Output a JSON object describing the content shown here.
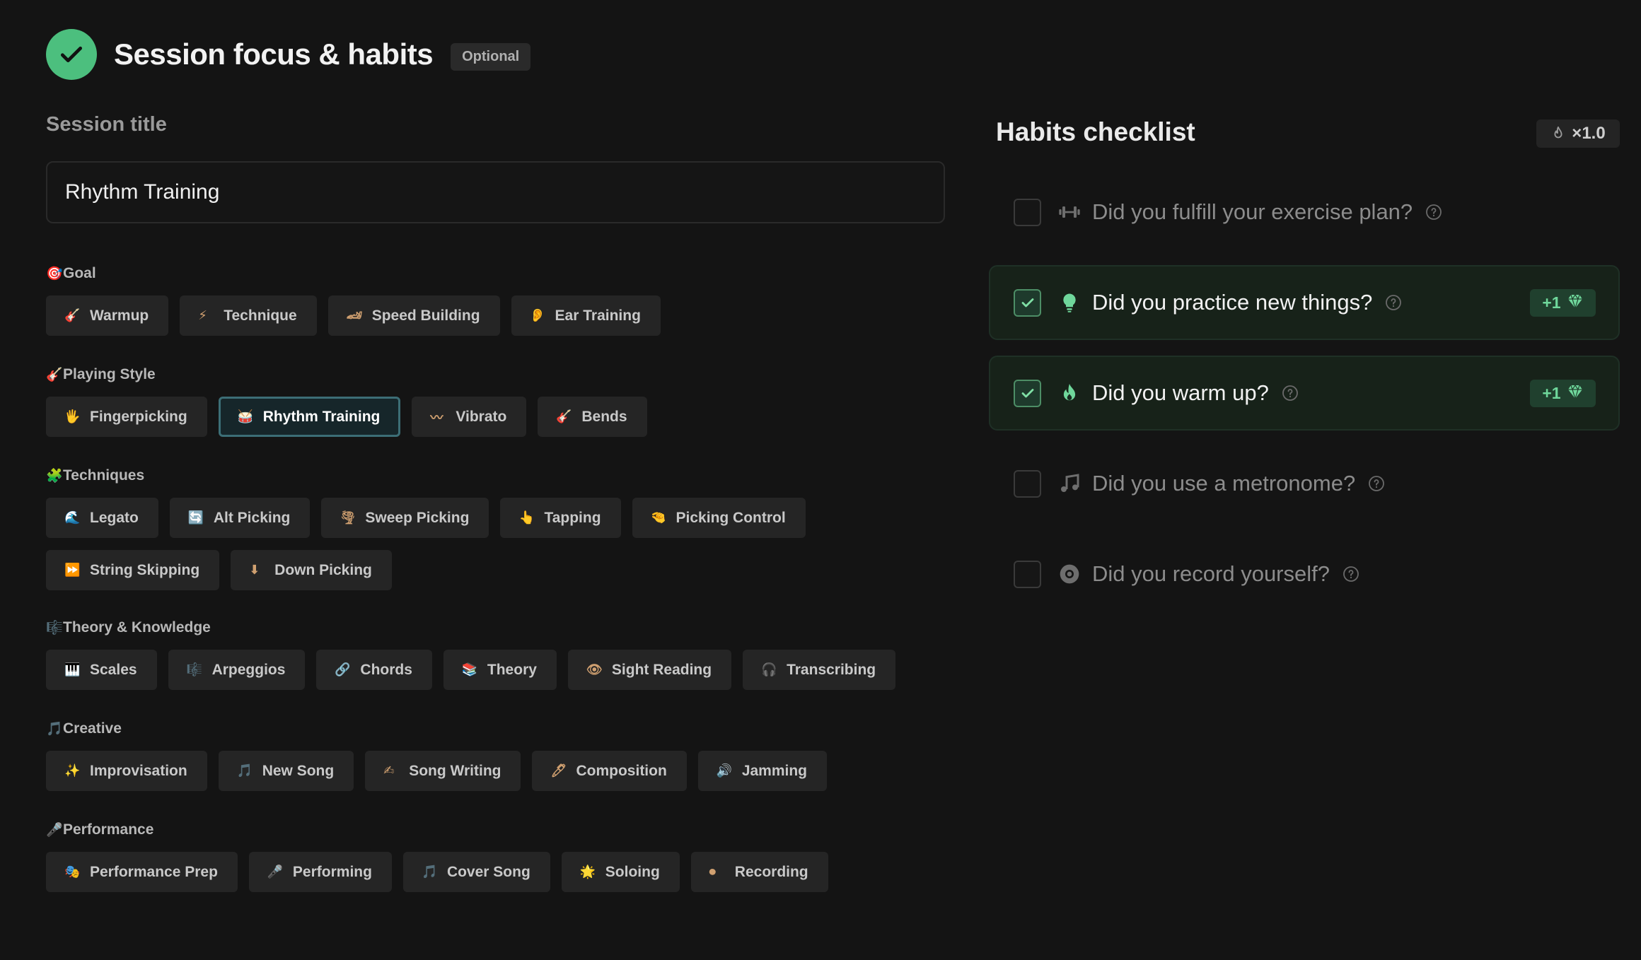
{
  "header": {
    "title": "Session focus & habits",
    "badge": "Optional"
  },
  "session_title": {
    "label": "Session title",
    "value": "Rhythm Training"
  },
  "groups": [
    {
      "icon": "🎯",
      "label": "Goal",
      "chips": [
        {
          "icon": "🎸",
          "label": "Warmup"
        },
        {
          "icon": "⚡",
          "label": "Technique"
        },
        {
          "icon": "🏎",
          "label": "Speed Building"
        },
        {
          "icon": "👂",
          "label": "Ear Training"
        }
      ]
    },
    {
      "icon": "🎸",
      "label": "Playing Style",
      "chips": [
        {
          "icon": "🖐",
          "label": "Fingerpicking"
        },
        {
          "icon": "🥁",
          "label": "Rhythm Training",
          "selected": true
        },
        {
          "icon": "〰",
          "label": "Vibrato"
        },
        {
          "icon": "🎸",
          "label": "Bends"
        }
      ]
    },
    {
      "icon": "🧩",
      "label": "Techniques",
      "chips": [
        {
          "icon": "🌊",
          "label": "Legato"
        },
        {
          "icon": "🔄",
          "label": "Alt Picking"
        },
        {
          "icon": "🌪",
          "label": "Sweep Picking"
        },
        {
          "icon": "👆",
          "label": "Tapping"
        },
        {
          "icon": "🤏",
          "label": "Picking Control"
        },
        {
          "icon": "⏩",
          "label": "String Skipping"
        },
        {
          "icon": "⬇",
          "label": "Down Picking"
        }
      ]
    },
    {
      "icon": "🎼",
      "label": "Theory & Knowledge",
      "chips": [
        {
          "icon": "🎹",
          "label": "Scales"
        },
        {
          "icon": "🎼",
          "label": "Arpeggios"
        },
        {
          "icon": "🔗",
          "label": "Chords"
        },
        {
          "icon": "📚",
          "label": "Theory"
        },
        {
          "icon": "👁",
          "label": "Sight Reading"
        },
        {
          "icon": "🎧",
          "label": "Transcribing"
        }
      ]
    },
    {
      "icon": "🎵",
      "label": "Creative",
      "chips": [
        {
          "icon": "✨",
          "label": "Improvisation"
        },
        {
          "icon": "🎵",
          "label": "New Song"
        },
        {
          "icon": "✍",
          "label": "Song Writing"
        },
        {
          "icon": "🖊",
          "label": "Composition"
        },
        {
          "icon": "🔊",
          "label": "Jamming"
        }
      ]
    },
    {
      "icon": "🎤",
      "label": "Performance",
      "chips": [
        {
          "icon": "🎭",
          "label": "Performance Prep"
        },
        {
          "icon": "🎤",
          "label": "Performing"
        },
        {
          "icon": "🎵",
          "label": "Cover Song"
        },
        {
          "icon": "🌟",
          "label": "Soloing"
        },
        {
          "icon": "⏺",
          "label": "Recording"
        }
      ]
    }
  ],
  "habits": {
    "title": "Habits checklist",
    "multiplier": "×1.0",
    "items": [
      {
        "label": "Did you fulfill your exercise plan?",
        "icon": "dumbbell-icon",
        "checked": false
      },
      {
        "label": "Did you practice new things?",
        "icon": "lightbulb-icon",
        "checked": true,
        "bonus": "+1"
      },
      {
        "label": "Did you warm up?",
        "icon": "flame-icon",
        "checked": true,
        "bonus": "+1"
      },
      {
        "label": "Did you use a metronome?",
        "icon": "music-note-icon",
        "checked": false
      },
      {
        "label": "Did you record yourself?",
        "icon": "record-icon",
        "checked": false
      }
    ]
  },
  "colors": {
    "accent_green": "#4cbf7e",
    "selected_border": "#3c6e76",
    "bonus_text": "#6fd79b"
  }
}
